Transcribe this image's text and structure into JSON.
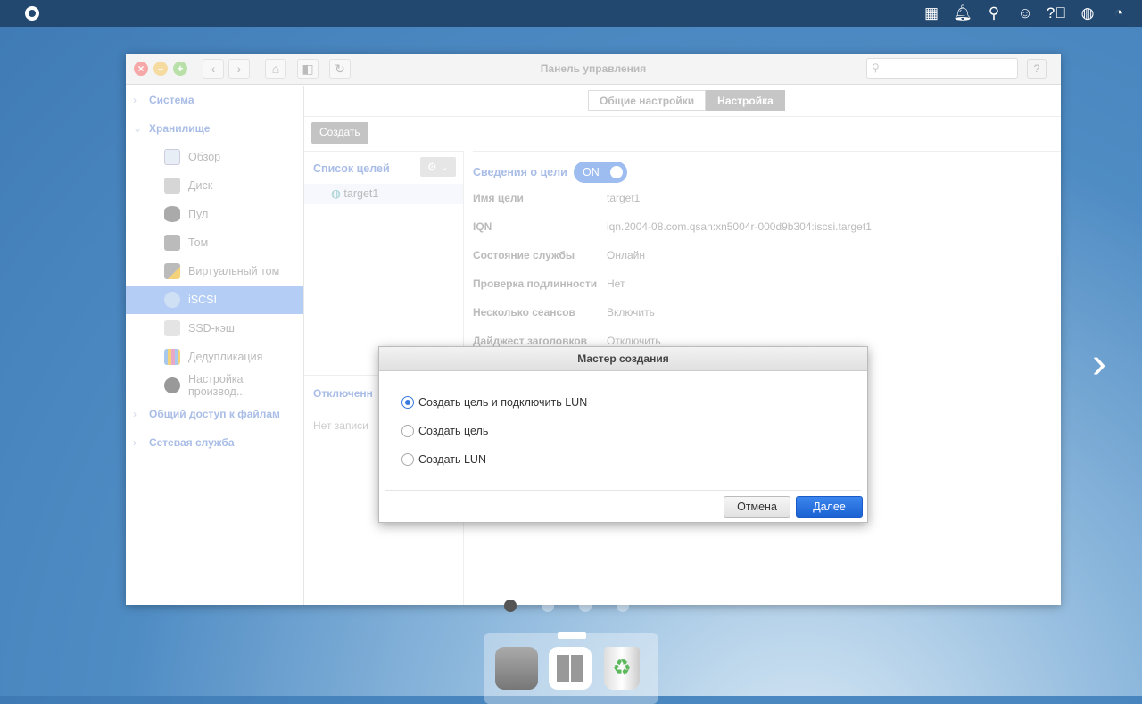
{
  "topbar": {
    "icons": [
      "apps-grid-icon",
      "bell-icon",
      "search-icon",
      "user-icon",
      "help-icon",
      "globe-icon",
      "dashboard-icon"
    ]
  },
  "window": {
    "title": "Панель управления",
    "search_placeholder": ""
  },
  "sidebar": {
    "groups": [
      {
        "label": "Система"
      },
      {
        "label": "Хранилище",
        "items": [
          {
            "label": "Обзор"
          },
          {
            "label": "Диск"
          },
          {
            "label": "Пул"
          },
          {
            "label": "Том"
          },
          {
            "label": "Виртуальный том"
          },
          {
            "label": "iSCSI"
          },
          {
            "label": "SSD-кэш"
          },
          {
            "label": "Дедупликация"
          },
          {
            "label": "Настройка производ..."
          }
        ]
      },
      {
        "label": "Общий доступ к файлам"
      },
      {
        "label": "Сетевая служба"
      }
    ]
  },
  "tabs": [
    "Общие настройки",
    "Настройка"
  ],
  "toolbar": {
    "create": "Создать"
  },
  "targets": {
    "title": "Список целей",
    "items": [
      "target1"
    ],
    "disconnected_title": "Отключенн",
    "no_records": "Нет записи"
  },
  "details": {
    "title": "Сведения о цели",
    "toggle": "ON",
    "rows": [
      {
        "k": "Имя цели",
        "v": "target1"
      },
      {
        "k": "IQN",
        "v": "iqn.2004-08.com.qsan:xn5004r-000d9b304:iscsi.target1"
      },
      {
        "k": "Состояние службы",
        "v": "Онлайн"
      },
      {
        "k": "Проверка подлинности",
        "v": "Нет"
      },
      {
        "k": "Несколько сеансов",
        "v": "Включить"
      },
      {
        "k": "Дайджест заголовков",
        "v": "Отключить"
      }
    ]
  },
  "dialog": {
    "title": "Мастер создания",
    "options": [
      {
        "label": "Создать цель и подключить LUN",
        "selected": true
      },
      {
        "label": "Создать цель",
        "selected": false
      },
      {
        "label": "Создать LUN",
        "selected": false
      }
    ],
    "cancel": "Отмена",
    "next": "Далее"
  },
  "page_dots": {
    "count": 4,
    "active": 1
  }
}
